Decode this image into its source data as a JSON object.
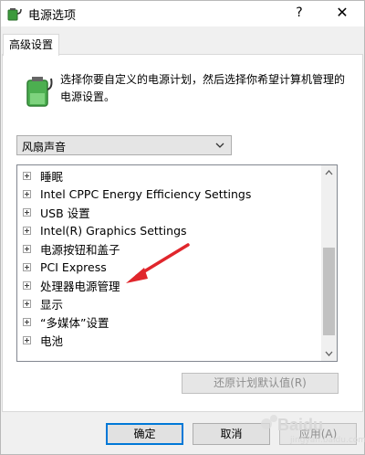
{
  "window": {
    "title": "电源选项",
    "help_label": "?",
    "close_label": "✕"
  },
  "tab": {
    "label": "高级设置"
  },
  "description": "选择你要自定义的电源计划，然后选择你希望计算机管理的电源设置。",
  "plan_select": {
    "value": "风扇声音",
    "icon": "chevron-down-icon"
  },
  "settings_tree": {
    "items": [
      {
        "label": "睡眠"
      },
      {
        "label": "Intel CPPC Energy Efficiency Settings"
      },
      {
        "label": "USB 设置"
      },
      {
        "label": "Intel(R) Graphics Settings"
      },
      {
        "label": "电源按钮和盖子"
      },
      {
        "label": "PCI Express"
      },
      {
        "label": "处理器电源管理"
      },
      {
        "label": "显示"
      },
      {
        "label": "“多媒体”设置"
      },
      {
        "label": "电池"
      }
    ]
  },
  "buttons": {
    "restore_defaults": "还原计划默认值(R)",
    "ok": "确定",
    "cancel": "取消",
    "apply": "应用(A)"
  },
  "annotation": {
    "arrow_color": "#e0262c"
  },
  "watermark": {
    "brand": "Baidu",
    "sub": "jingyan.baidu.com"
  }
}
